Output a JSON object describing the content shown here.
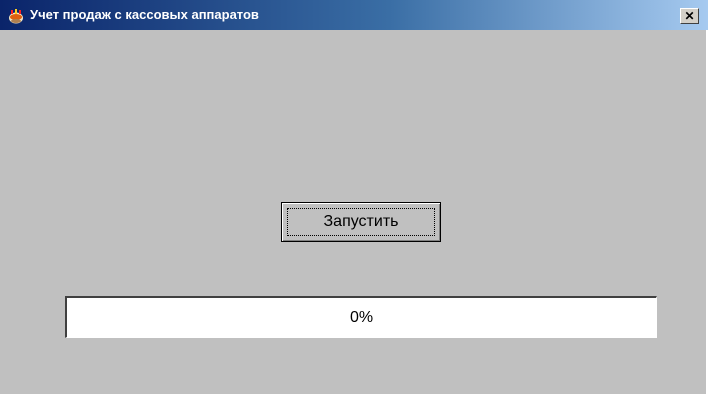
{
  "window": {
    "title": "Учет продаж с кассовых аппаратов",
    "icon": "app-icon",
    "close_label": "✕"
  },
  "main": {
    "run_button_label": "Запустить",
    "progress": {
      "value_percent": 0,
      "label": "0%"
    }
  },
  "colors": {
    "titlebar_start": "#0a246a",
    "titlebar_end": "#a6caf0",
    "window_background": "#c0c0c0",
    "progress_background": "#ffffff"
  }
}
